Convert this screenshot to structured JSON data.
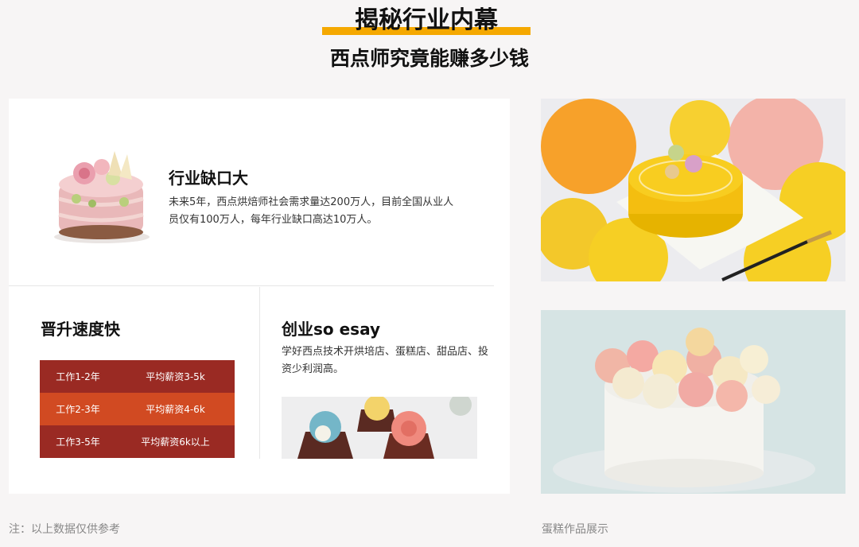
{
  "header": {
    "title": "揭秘行业内幕",
    "subtitle": "西点师究竟能赚多少钱"
  },
  "industry": {
    "title": "行业缺口大",
    "desc": "未来5年，西点烘焙师社会需求量达200万人，目前全国从业人员仅有100万人，每年行业缺口高达10万人。"
  },
  "promotion": {
    "title": "晋升速度快",
    "rows": [
      {
        "years": "工作1-2年",
        "salary": "平均薪资3-5k"
      },
      {
        "years": "工作2-3年",
        "salary": "平均薪资4-6k"
      },
      {
        "years": "工作3-5年",
        "salary": "平均薪资6k以上"
      }
    ]
  },
  "business": {
    "title": "创业so esay",
    "desc": "学好西点技术开烘培店、蛋糕店、甜品店、投资少利润高。"
  },
  "footer": {
    "note": "注：以上数据仅供参考",
    "caption": "蛋糕作品展示"
  },
  "colors": {
    "accent": "#f5a800",
    "row_dark": "#9a2a23",
    "row_light": "#d14a22"
  }
}
